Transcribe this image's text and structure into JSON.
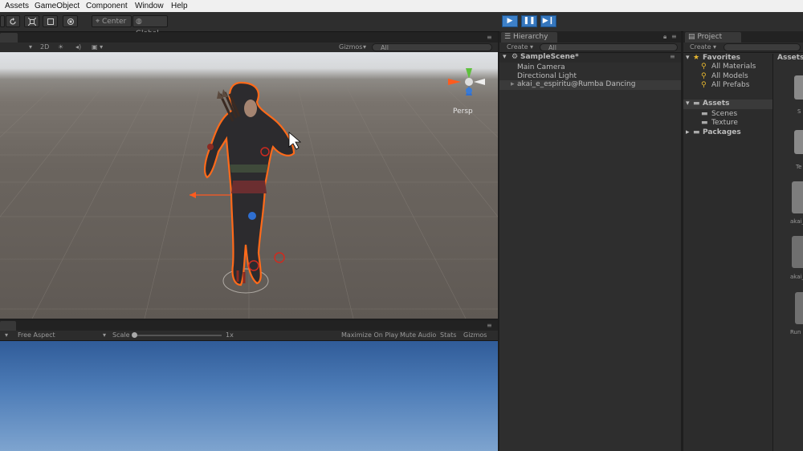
{
  "menu": {
    "items": [
      "Assets",
      "GameObject",
      "Component",
      "Window",
      "Help"
    ]
  },
  "toolbar": {
    "pivot_label": "Center",
    "space_label": "Global"
  },
  "scene_view": {
    "mode_2d": "2D",
    "gizmos_label": "Gizmos",
    "search_placeholder": "All",
    "persp_label": "Persp"
  },
  "game_view": {
    "aspect_label": "Free Aspect",
    "scale_label": "Scale",
    "scale_value": "1x",
    "maximize_label": "Maximize On Play",
    "mute_label": "Mute Audio",
    "stats_label": "Stats",
    "gizmos_label": "Gizmos"
  },
  "hierarchy": {
    "tab": "Hierarchy",
    "create_label": "Create",
    "search_placeholder": "All",
    "scene_name": "SampleScene*",
    "items": [
      "Main Camera",
      "Directional Light",
      "akai_e_espiritu@Rumba Dancing"
    ]
  },
  "project": {
    "tab": "Project",
    "create_label": "Create",
    "favorites_label": "Favorites",
    "favorites": [
      "All Materials",
      "All Models",
      "All Prefabs"
    ],
    "assets_label": "Assets",
    "asset_folders": [
      "Scenes",
      "Texture"
    ],
    "packages_label": "Packages",
    "assets_header": "Assets",
    "grid_labels": [
      "S",
      "Te",
      "akai_",
      "akai_",
      "Run"
    ]
  },
  "colors": {
    "play_active": "#3d80c8",
    "selection_outline": "#ff6a1a",
    "y_axis": "#5ec13c",
    "z_axis": "#3a7bd5"
  }
}
